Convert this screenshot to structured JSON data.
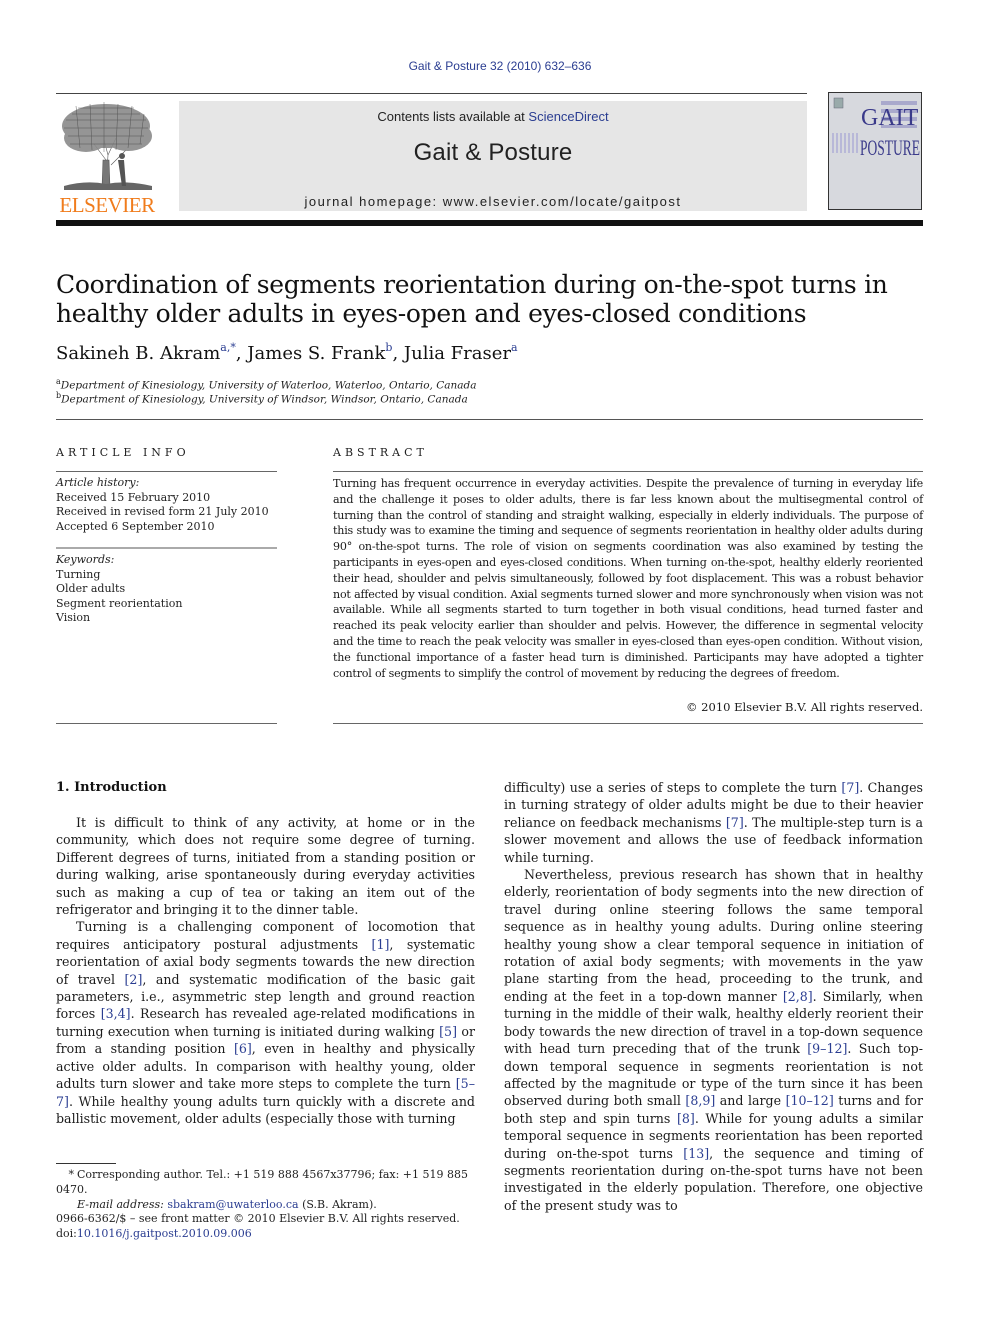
{
  "header": {
    "journal_reference": "Gait & Posture 32 (2010) 632–636",
    "contents_prefix": "Contents lists available at ",
    "contents_link": "ScienceDirect",
    "journal_title": "Gait & Posture",
    "homepage_label": "journal homepage: www.elsevier.com/locate/gaitpost",
    "publisher_logo_text": "ELSEVIER",
    "cover": {
      "title_line1": "GAIT",
      "title_line2": "POSTURE"
    }
  },
  "article": {
    "title": "Coordination of segments reorientation during on-the-spot turns in healthy older adults in eyes-open and eyes-closed conditions",
    "authors": [
      {
        "name": "Sakineh B. Akram",
        "sup": "a,*"
      },
      {
        "name": "James S. Frank",
        "sup": "b"
      },
      {
        "name": "Julia Fraser",
        "sup": "a"
      }
    ],
    "affiliations": [
      {
        "sup": "a",
        "text": "Department of Kinesiology, University of Waterloo, Waterloo, Ontario, Canada"
      },
      {
        "sup": "b",
        "text": "Department of Kinesiology, University of Windsor, Windsor, Ontario, Canada"
      }
    ]
  },
  "article_info": {
    "heading": "ARTICLE INFO",
    "history_label": "Article history:",
    "history": [
      "Received 15 February 2010",
      "Received in revised form 21 July 2010",
      "Accepted 6 September 2010"
    ],
    "keywords_label": "Keywords:",
    "keywords": [
      "Turning",
      "Older adults",
      "Segment reorientation",
      "Vision"
    ]
  },
  "abstract": {
    "heading": "ABSTRACT",
    "text": "Turning has frequent occurrence in everyday activities. Despite the prevalence of turning in everyday life and the challenge it poses to older adults, there is far less known about the multisegmental control of turning than the control of standing and straight walking, especially in elderly individuals. The purpose of this study was to examine the timing and sequence of segments reorientation in healthy older adults during 90° on-the-spot turns. The role of vision on segments coordination was also examined by testing the participants in eyes-open and eyes-closed conditions. When turning on-the-spot, healthy elderly reoriented their head, shoulder and pelvis simultaneously, followed by foot displacement. This was a robust behavior not affected by visual condition. Axial segments turned slower and more synchronously when vision was not available. While all segments started to turn together in both visual conditions, head turned faster and reached its peak velocity earlier than shoulder and pelvis. However, the difference in segmental velocity and the time to reach the peak velocity was smaller in eyes-closed than eyes-open condition. Without vision, the functional importance of a faster head turn is diminished. Participants may have adopted a tighter control of segments to simplify the control of movement by reducing the degrees of freedom.",
    "copyright": "© 2010 Elsevier B.V. All rights reserved."
  },
  "body": {
    "section_heading": "1.  Introduction",
    "left_column": [
      {
        "segments": [
          {
            "t": "It is difficult to think of any activity, at home or in the community, which does not require some degree of turning. Different degrees of turns, initiated from a standing position or during walking, arise spontaneously during everyday activities such as making a cup of tea or taking an item out of the refrigerator and bringing it to the dinner table."
          }
        ]
      },
      {
        "segments": [
          {
            "t": "Turning is a challenging component of locomotion that requires anticipatory postural adjustments "
          },
          {
            "ref": "[1]"
          },
          {
            "t": ", systematic reorientation of axial body segments towards the new direction of travel "
          },
          {
            "ref": "[2]"
          },
          {
            "t": ", and systematic modification of the basic gait parameters, i.e., asymmetric step length and ground reaction forces "
          },
          {
            "ref": "[3,4]"
          },
          {
            "t": ". Research has revealed age-related modifications in turning execution when turning is initiated during walking "
          },
          {
            "ref": "[5]"
          },
          {
            "t": " or from a standing position "
          },
          {
            "ref": "[6]"
          },
          {
            "t": ", even in healthy and physically active older adults. In comparison with healthy young, older adults turn slower and take more steps to complete the turn "
          },
          {
            "ref": "[5–7]"
          },
          {
            "t": ". While healthy young adults turn quickly with a discrete and ballistic movement, older adults (especially those with turning"
          }
        ]
      }
    ],
    "right_column": [
      {
        "noindent": true,
        "segments": [
          {
            "t": "difficulty) use a series of steps to complete the turn "
          },
          {
            "ref": "[7]"
          },
          {
            "t": ". Changes in turning strategy of older adults might be due to their heavier reliance on feedback mechanisms "
          },
          {
            "ref": "[7]"
          },
          {
            "t": ". The multiple-step turn is a slower movement and allows the use of feedback information while turning."
          }
        ]
      },
      {
        "segments": [
          {
            "t": "Nevertheless, previous research has shown that in healthy elderly, reorientation of body segments into the new direction of travel during online steering follows the same temporal sequence as in healthy young adults. During online steering healthy young show a clear temporal sequence in initiation of rotation of axial body segments; with movements in the yaw plane starting from the head, proceeding to the trunk, and ending at the feet in a top-down manner "
          },
          {
            "ref": "[2,8]"
          },
          {
            "t": ". Similarly, when turning in the middle of their walk, healthy elderly reorient their body towards the new direction of travel in a top-down sequence with head turn preceding that of the trunk "
          },
          {
            "ref": "[9–12]"
          },
          {
            "t": ". Such top-down temporal sequence in segments reorientation is not affected by the magnitude or type of the turn since it has been observed during both small "
          },
          {
            "ref": "[8,9]"
          },
          {
            "t": " and large "
          },
          {
            "ref": "[10–12]"
          },
          {
            "t": " turns and for both step and spin turns "
          },
          {
            "ref": "[8]"
          },
          {
            "t": ". While for young adults a similar temporal sequence in segments reorientation has been reported during on-the-spot turns "
          },
          {
            "ref": "[13]"
          },
          {
            "t": ", the sequence and timing of segments reorientation during on-the-spot turns have not been investigated in the elderly population. Therefore, one objective of the present study was to"
          }
        ]
      }
    ]
  },
  "footnotes": {
    "star": "*",
    "corresponding": "Corresponding author. Tel.: +1 519 888 4567x37796; fax: +1 519 885 0470.",
    "email_label": "E-mail address: ",
    "email": "sbakram@uwaterloo.ca",
    "email_suffix": " (S.B. Akram).",
    "issn": "0966-6362/$ – see front matter © 2010 Elsevier B.V. All rights reserved.",
    "doi_prefix": "doi:",
    "doi": "10.1016/j.gaitpost.2010.09.006"
  },
  "colors": {
    "link": "#2a3d91",
    "elsevier_orange": "#f07c1c",
    "header_box": "#e6e6e6"
  }
}
